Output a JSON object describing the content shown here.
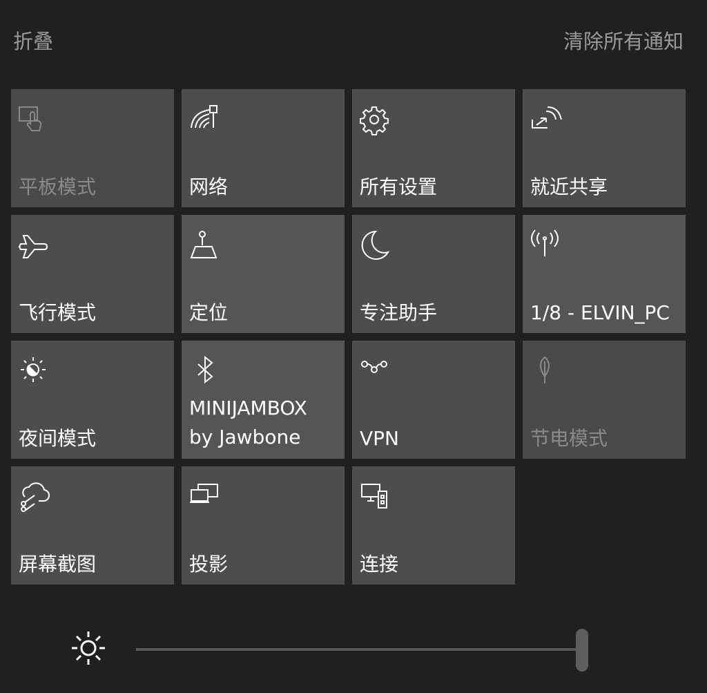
{
  "header": {
    "collapse_label": "折叠",
    "clear_all_label": "清除所有通知"
  },
  "tiles": [
    {
      "label": "平板模式",
      "icon": "tablet-mode-icon",
      "state": "disabled"
    },
    {
      "label": "网络",
      "icon": "network-icon",
      "state": "off"
    },
    {
      "label": "所有设置",
      "icon": "gear-icon",
      "state": "off"
    },
    {
      "label": "就近共享",
      "icon": "nearby-share-icon",
      "state": "off"
    },
    {
      "label": "飞行模式",
      "icon": "airplane-icon",
      "state": "off"
    },
    {
      "label": "定位",
      "icon": "location-icon",
      "state": "on"
    },
    {
      "label": "专注助手",
      "icon": "moon-icon",
      "state": "off"
    },
    {
      "label": "1/8 - ELVIN_PC",
      "icon": "hotspot-icon",
      "state": "on"
    },
    {
      "label": "夜间模式",
      "icon": "night-light-icon",
      "state": "off"
    },
    {
      "label": "MINIJAMBOX\nby Jawbone",
      "icon": "bluetooth-icon",
      "state": "on"
    },
    {
      "label": "VPN",
      "icon": "vpn-icon",
      "state": "off"
    },
    {
      "label": "节电模式",
      "icon": "battery-saver-icon",
      "state": "disabled"
    },
    {
      "label": "屏幕截图",
      "icon": "screen-snip-icon",
      "state": "off"
    },
    {
      "label": "投影",
      "icon": "project-icon",
      "state": "off"
    },
    {
      "label": "连接",
      "icon": "connect-icon",
      "state": "off"
    }
  ],
  "brightness": {
    "icon": "brightness-sun-icon",
    "level": 1.0
  }
}
